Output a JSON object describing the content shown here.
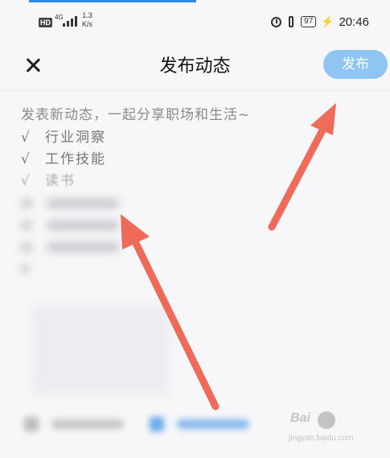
{
  "status_bar": {
    "hd_badge": "HD",
    "network": "4G",
    "speed_value": "1.3",
    "speed_unit": "K/s",
    "battery": "97",
    "time": "20:46"
  },
  "header": {
    "title": "发布动态",
    "publish_label": "发布"
  },
  "editor": {
    "placeholder": "发表新动态，一起分享职场和生活~",
    "tips": [
      {
        "check": "√",
        "label": "行业洞察"
      },
      {
        "check": "√",
        "label": "工作技能"
      },
      {
        "check": "√",
        "label": "读书"
      }
    ]
  },
  "watermark": {
    "brand": "Bai",
    "url": "jingyan.baidu.com"
  },
  "colors": {
    "accent": "#8ec5f3",
    "annotation_arrow": "#ee6b5a"
  }
}
